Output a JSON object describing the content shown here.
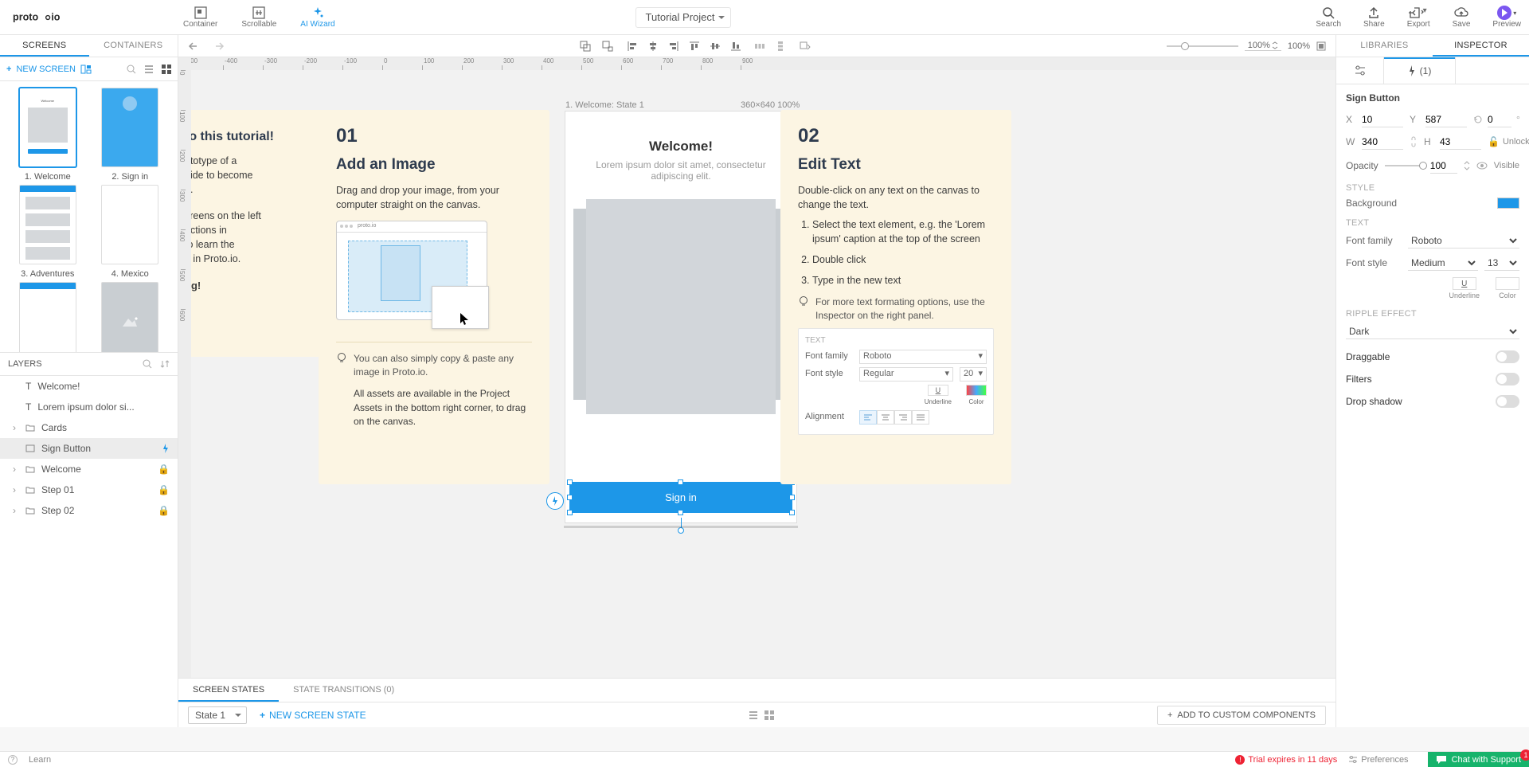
{
  "top": {
    "container": "Container",
    "scrollable": "Scrollable",
    "aiwizard": "AI Wizard",
    "project": "Tutorial Project",
    "search": "Search",
    "share": "Share",
    "export": "Export",
    "save": "Save",
    "preview": "Preview"
  },
  "left_tabs": {
    "screens": "SCREENS",
    "containers": "CONTAINERS"
  },
  "right_tabs": {
    "libraries": "LIBRARIES",
    "inspector": "INSPECTOR"
  },
  "newscreen": "NEW SCREEN",
  "zoom": {
    "field": "100%",
    "label": "100%"
  },
  "screens": [
    {
      "label": "1. Welcome"
    },
    {
      "label": "2. Sign in"
    },
    {
      "label": "3. Adventures"
    },
    {
      "label": "4. Mexico"
    },
    {
      "label": ""
    },
    {
      "label": ""
    }
  ],
  "layers_header": "LAYERS",
  "layers": [
    {
      "label": "Welcome!",
      "type": "T"
    },
    {
      "label": "Lorem ipsum dolor si...",
      "type": "T"
    },
    {
      "label": "Cards",
      "type": "G"
    },
    {
      "label": "Sign Button",
      "type": "R",
      "sel": true,
      "bolt": true
    },
    {
      "label": "Welcome",
      "type": "G",
      "locked": true
    },
    {
      "label": "Step 01",
      "type": "G",
      "locked": true
    },
    {
      "label": "Step 02",
      "type": "G",
      "locked": true
    }
  ],
  "artboard": {
    "label": "1. Welcome: State 1",
    "dims": "360×640   100%",
    "title": "Welcome!",
    "caption": "Lorem ipsum dolor sit amet, consectetur adipiscing elit.",
    "button": "Sign in"
  },
  "intro": {
    "title": "to this tutorial!",
    "p1": "ototype of a",
    "p2": "uide to become",
    "p3": "o.",
    "p4": "creens on the left",
    "p5": "uctions in",
    "p6": "to learn the",
    "p7": "g in Proto.io.",
    "p8": "ng!"
  },
  "step1": {
    "num": "01",
    "title": "Add an Image",
    "p": "Drag and drop your image, from your computer straight on the canvas.",
    "tip": "You can also simply copy & paste any image in Proto.io.",
    "tip2": "All assets are available in the Project Assets in the bottom right corner, to drag on the canvas."
  },
  "step2": {
    "num": "02",
    "title": "Edit Text",
    "p": "Double-click on any text on the canvas to change the text.",
    "li1": "Select the text element, e.g. the 'Lorem ipsum' caption at the top of the screen",
    "li2": "Double click",
    "li3": "Type in the new text",
    "tip": "For more text formating options, use the Inspector on the right panel.",
    "mini": {
      "text": "TEXT",
      "ff": "Font family",
      "ffv": "Roboto",
      "fs": "Font style",
      "fsv": "Regular",
      "sz": "20",
      "ul": "Underline",
      "cl": "Color",
      "al": "Alignment"
    }
  },
  "states": {
    "tab1": "SCREEN STATES",
    "tab2": "STATE TRANSITIONS (0)",
    "dd": "State 1",
    "new": "NEW SCREEN STATE",
    "addcomp": "ADD TO CUSTOM COMPONENTS"
  },
  "inspector": {
    "int_count": "(1)",
    "name": "Sign Button",
    "x": "10",
    "y": "587",
    "rot": "0",
    "deg": "°",
    "w": "340",
    "h": "43",
    "unlocked": "Unlocked",
    "opacity_l": "Opacity",
    "opacity": "100",
    "visible": "Visible",
    "style": "STYLE",
    "bg": "Background",
    "text": "TEXT",
    "ff": "Font family",
    "ffv": "Roboto",
    "fs": "Font style",
    "fsv": "Medium",
    "sz": "13",
    "ul": "Underline",
    "cl": "Color",
    "ripple": "RIPPLE EFFECT",
    "ripplev": "Dark",
    "drag": "Draggable",
    "filt": "Filters",
    "shadow": "Drop shadow"
  },
  "status": {
    "learn": "Learn",
    "trial": "Trial expires in 11 days",
    "prefs": "Preferences",
    "chat": "Chat with Support",
    "badge": "1"
  }
}
